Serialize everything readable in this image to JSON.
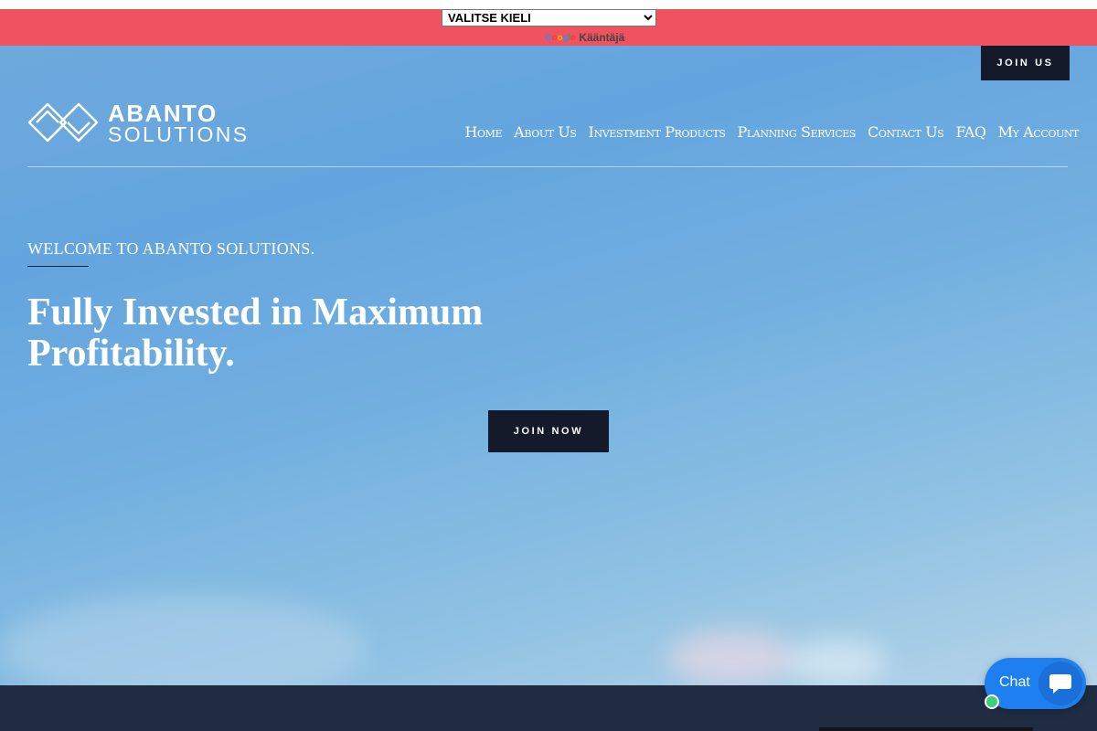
{
  "translate": {
    "select_value": "VALITSE KIELI",
    "google_logo": "Google",
    "label": "Kääntäjä"
  },
  "header": {
    "join_us_label": "JOIN US",
    "logo": {
      "line1": "ABANTO",
      "line2": "SOLUTIONS"
    },
    "nav": [
      {
        "label": "Home"
      },
      {
        "label": "About Us"
      },
      {
        "label": "Investment Products"
      },
      {
        "label": "Planning Services"
      },
      {
        "label": "Contact Us"
      },
      {
        "label": "FAQ"
      },
      {
        "label": "My Account"
      }
    ]
  },
  "hero": {
    "welcome": "WELCOME TO ABANTO SOLUTIONS.",
    "headline": "Fully Invested in Maximum Profitability.",
    "cta_label": "JOIN NOW"
  },
  "chat": {
    "label": "Chat",
    "icon": "chat-bubble-icon",
    "status": "online"
  },
  "colors": {
    "translate_bar": "#f0525f",
    "dark_button": "#151a2b",
    "footer": "#1f2c42",
    "chat_blue": "#1e7ff0",
    "status_green": "#3ed07a"
  }
}
